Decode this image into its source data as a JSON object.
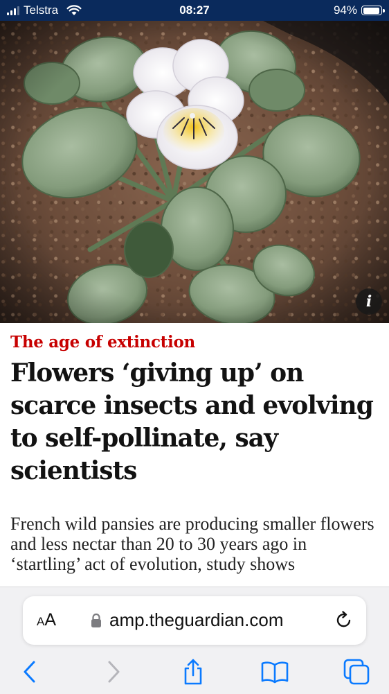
{
  "status_bar": {
    "carrier": "Telstra",
    "time": "08:27",
    "battery_percent": "94%",
    "battery_level": 0.94,
    "signal_bars": 3,
    "signal_bars_total": 4
  },
  "hero": {
    "info_label": "i"
  },
  "article": {
    "kicker": "The age of extinction",
    "headline": "Flowers ‘giving up’ on scarce insects and evolving to self-pollinate, say scientists",
    "standfirst": "French wild pansies are producing smaller flowers and less nectar than 20 to 30 years ago in ‘startling’ act of evolution, study shows"
  },
  "browser": {
    "aa_label_small": "A",
    "aa_label_large": "A",
    "url": "amp.theguardian.com"
  },
  "icons": [
    "signal-icon",
    "wifi-icon",
    "battery-icon",
    "info-icon",
    "lock-icon",
    "reload-icon",
    "back-icon",
    "forward-icon",
    "share-icon",
    "bookmarks-icon",
    "tabs-icon"
  ],
  "colors": {
    "status_bar_bg": "#0a2a5c",
    "kicker": "#c70000",
    "ios_blue": "#0a7aff"
  }
}
